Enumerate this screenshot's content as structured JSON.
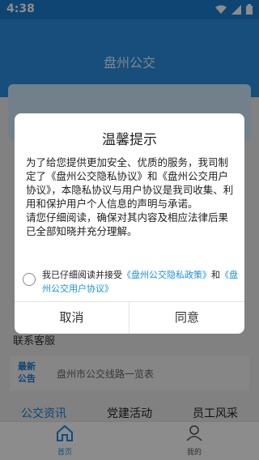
{
  "statusbar": {
    "time": "4:38"
  },
  "header": {
    "title": "盘州公交"
  },
  "background": {
    "contact": "联系客服",
    "notice_tag": "最新公告",
    "notice_text": "盘州市公交线路一览表",
    "tabs": [
      "公交资讯",
      "党建活动",
      "员工风采"
    ]
  },
  "bottom_nav": [
    {
      "label": "首页",
      "icon": "home-icon"
    },
    {
      "label": "我的",
      "icon": "user-icon"
    }
  ],
  "dialog": {
    "title": "温馨提示",
    "paragraph1": "为了给您提供更加安全、优质的服务，我司制定了《盘州公交隐私协议》和《盘州公交用户协议》，本隐私协议与用户协议是我司收集、利用和保护用户个人信息的声明与承诺。",
    "paragraph2": "请您仔细阅读，确保对其内容及相应法律后果已全部知晓并充分理解。",
    "agree_prefix": "我已仔细阅读并接受",
    "privacy_link": "《盘州公交隐私政策》",
    "agree_and": "和",
    "user_link": "《盘州公交用户协议》",
    "cancel": "取消",
    "confirm": "同意"
  },
  "colors": {
    "primary": "#2a8ee0",
    "link": "#1a8fe3"
  }
}
